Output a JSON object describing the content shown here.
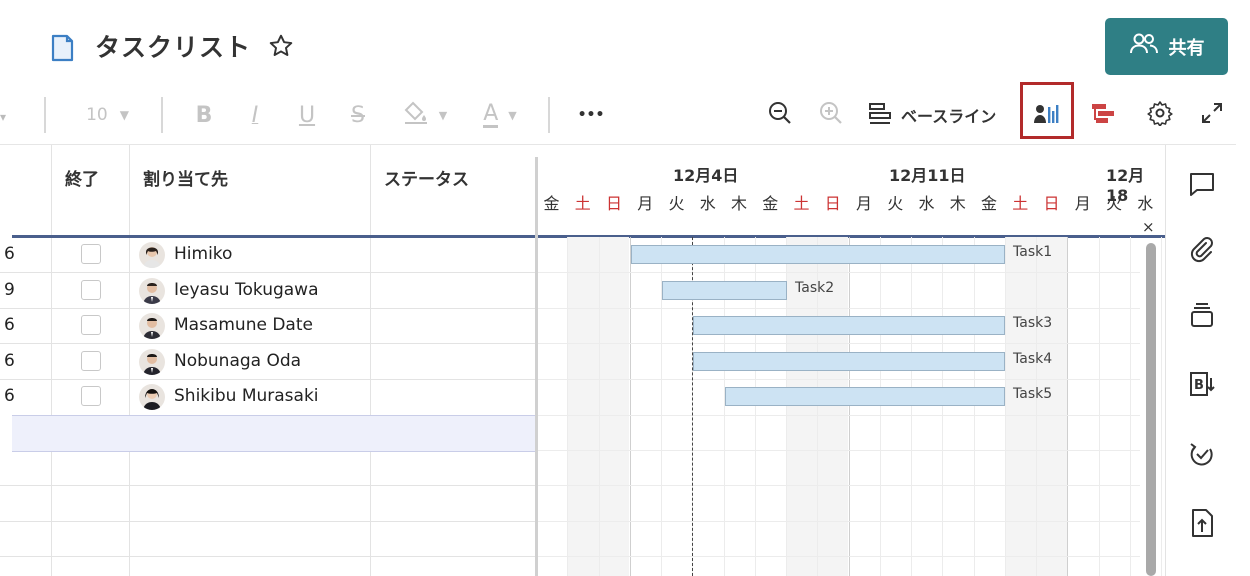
{
  "header": {
    "title": "タスクリスト",
    "share_label": "共有"
  },
  "toolbar": {
    "font_size": "10",
    "bold": "B",
    "italic": "I",
    "underline": "U",
    "strike": "S",
    "font_color": "A",
    "more": "•••",
    "baseline_label": "ベースライン"
  },
  "grid": {
    "columns": [
      "終了",
      "割り当て先",
      "ステータス"
    ],
    "rows": [
      {
        "end": "6",
        "assignee": "Himiko",
        "checked": false
      },
      {
        "end": "9",
        "assignee": "Ieyasu Tokugawa",
        "checked": false
      },
      {
        "end": "6",
        "assignee": "Masamune Date",
        "checked": false
      },
      {
        "end": "6",
        "assignee": "Nobunaga Oda",
        "checked": false
      },
      {
        "end": "6",
        "assignee": "Shikibu Murasaki",
        "checked": false
      }
    ]
  },
  "gantt": {
    "weeks": [
      "12月4日",
      "12月11日",
      "12月18"
    ],
    "days": [
      "金",
      "土",
      "日",
      "月",
      "火",
      "水",
      "木",
      "金",
      "土",
      "日",
      "月",
      "火",
      "水",
      "木",
      "金",
      "土",
      "日",
      "月",
      "火",
      "水"
    ],
    "weekend_days": [
      "土",
      "日"
    ],
    "close_symbol": "×",
    "tasks": [
      "Task1",
      "Task2",
      "Task3",
      "Task4",
      "Task5"
    ]
  },
  "colors": {
    "accent": "#2f7f85",
    "weekend_text": "#cc3333",
    "bar_fill": "#cde3f3",
    "highlight": "#b22a2a"
  }
}
